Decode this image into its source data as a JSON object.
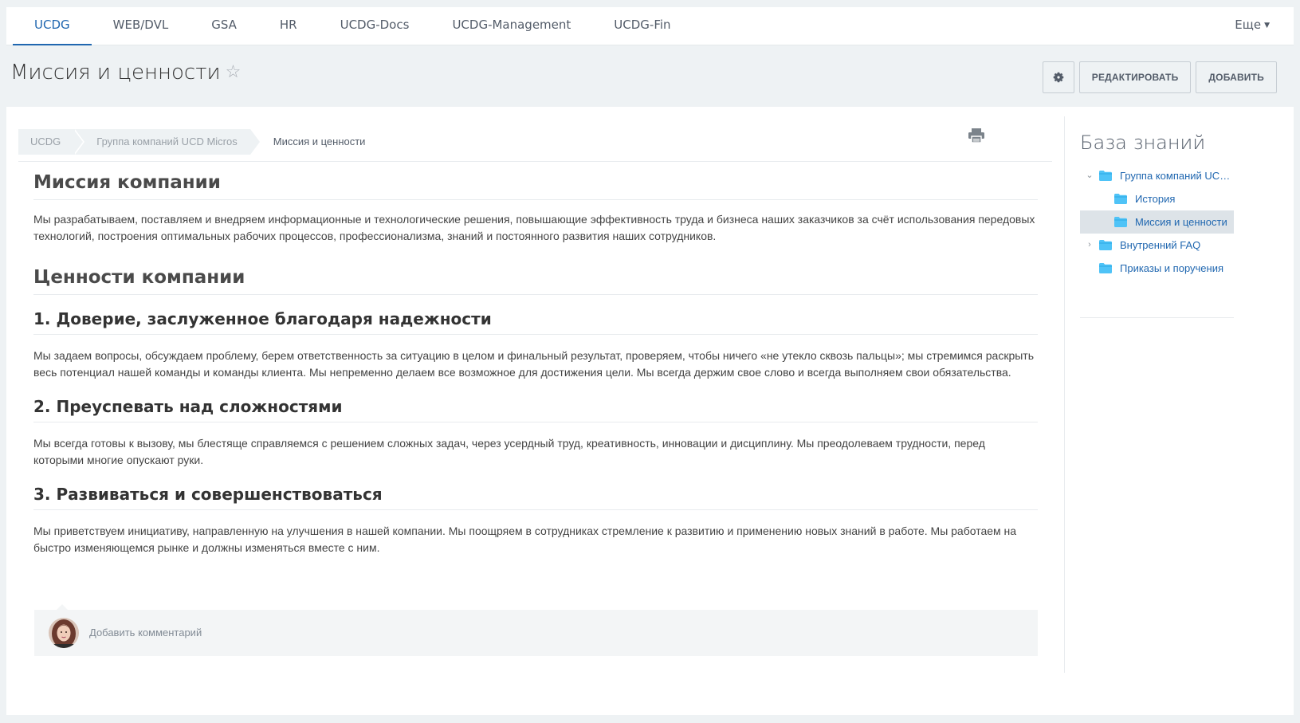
{
  "nav": {
    "tabs": [
      "UCDG",
      "WEB/DVL",
      "GSA",
      "HR",
      "UCDG-Docs",
      "UCDG-Management",
      "UCDG-Fin"
    ],
    "active_tab": "UCDG",
    "more_label": "Еще"
  },
  "header": {
    "title": "Миссия и ценности",
    "edit_label": "РЕДАКТИРОВАТЬ",
    "add_label": "ДОБАВИТЬ"
  },
  "breadcrumbs": [
    "UCDG",
    "Группа компаний UCD Micros",
    "Миссия и ценности"
  ],
  "article": {
    "mission_heading": "Миссия компании",
    "mission_text": "Мы разрабатываем, поставляем и внедряем информационные и технологические решения, повышающие эффективность труда и бизнеса наших заказчиков за счёт использования передовых технологий, построения оптимальных рабочих процессов, профессионализма, знаний и постоянного развития наших сотрудников.",
    "values_heading": "Ценности компании",
    "values": [
      {
        "title": "1. Доверие, заслуженное благодаря надежности",
        "text": "Мы задаем вопросы, обсуждаем проблему, берем ответственность за ситуацию в целом и финальный результат, проверяем, чтобы ничего «не утекло сквозь пальцы»; мы стремимся раскрыть весь потенциал нашей команды и команды клиента. Мы непременно делаем все возможное для достижения цели. Мы всегда держим свое слово и всегда выполняем свои обязательства."
      },
      {
        "title": "2. Преуспевать над сложностями",
        "text": "Мы всегда готовы к вызову, мы блестяще справляемся с решением сложных задач, через усердный труд, креативность, инновации и дисциплину. Мы преодолеваем трудности, перед которыми многие опускают руки."
      },
      {
        "title": "3. Развиваться и совершенствоваться",
        "text": "Мы приветствуем инициативу, направленную на улучшения в нашей компании. Мы поощряем в сотрудниках стремление к развитию и применению новых знаний в работе. Мы работаем на быстро изменяющемся рынке и должны изменяться вместе с ним."
      }
    ]
  },
  "comment": {
    "placeholder": "Добавить комментарий"
  },
  "sidebar": {
    "title": "База знаний",
    "tree": [
      {
        "label": "Группа компаний UCD Micros",
        "level": 0,
        "toggle": "expanded"
      },
      {
        "label": "История",
        "level": 1
      },
      {
        "label": "Миссия и ценности",
        "level": 1,
        "selected": true
      },
      {
        "label": "Внутренний FAQ",
        "level": 0,
        "toggle": "collapsed"
      },
      {
        "label": "Приказы и поручения",
        "level": 0
      }
    ]
  },
  "colors": {
    "accent": "#2067b0",
    "folder": "#4fc3f7",
    "page_bg": "#eef2f4"
  }
}
